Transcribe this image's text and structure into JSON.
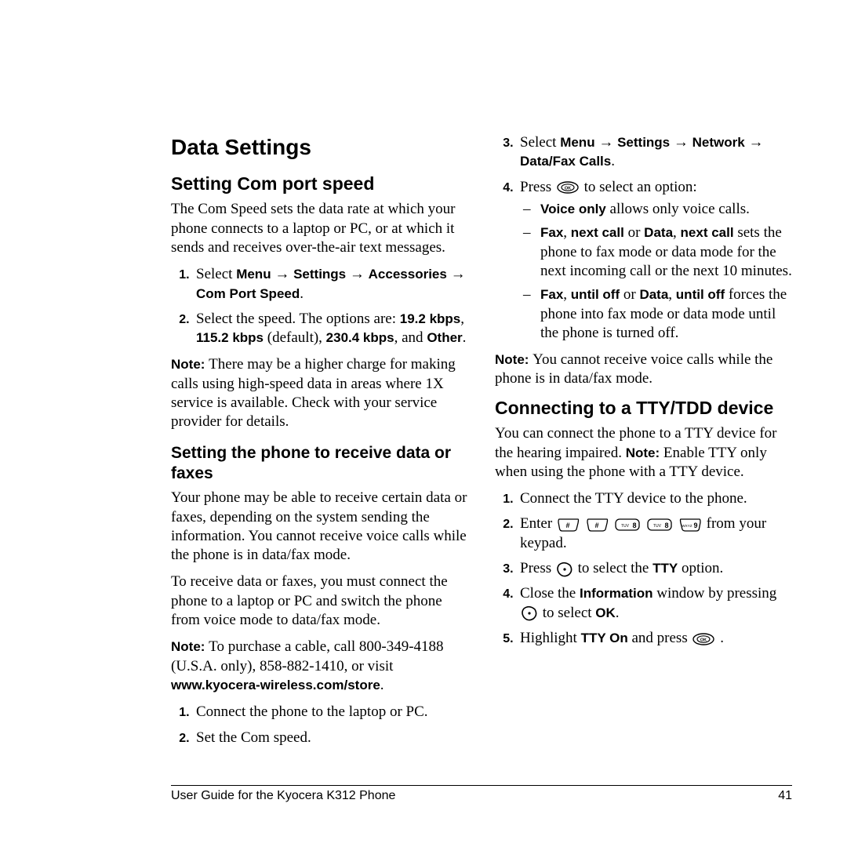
{
  "left": {
    "h1": "Data Settings",
    "h2_com": "Setting Com port speed",
    "p_com": "The Com Speed sets the data rate at which your phone connects to a laptop or PC, or at which it sends and receives over-the-air text messages.",
    "step1_a": "Select ",
    "step1_menu": "Menu",
    "step1_settings": "Settings",
    "step1_acc": "Accessories",
    "step1_com": "Com Port Speed",
    "step2_a": "Select the speed. The options are: ",
    "step2_k192": "19.2 kbps",
    "step2_mid": ", ",
    "step2_k1152": "115.2 kbps",
    "step2_def": " (default), ",
    "step2_k2304": "230.4 kbps",
    "step2_and": ", and ",
    "step2_other": "Other",
    "note1_lbl": "Note:  ",
    "note1_txt": "There may be a higher charge for making calls using high-speed data in areas where 1X service is available. Check with your service provider for details.",
    "h3_fax": "Setting the phone to receive data or faxes",
    "p_fax1": "Your phone may be able to receive certain data or faxes, depending on the system sending the information. You cannot receive voice calls while the phone is in data/fax mode.",
    "p_fax2": "To receive data or faxes, you must connect the phone to a laptop or PC and switch the phone from voice mode to data/fax mode.",
    "note2_lbl": "Note:  ",
    "note2_txt": "To purchase a cable, call 800-349-4188 (U.S.A. only), 858-882-1410, or visit ",
    "note2_url": "www.kyocera-wireless.com/store",
    "fax_s1": "Connect the phone to the laptop or PC.",
    "fax_s2": "Set the Com speed."
  },
  "right": {
    "s3_a": "Select ",
    "s3_menu": "Menu",
    "s3_settings": "Settings",
    "s3_network": "Network",
    "s3_datafax": "Data/Fax Calls",
    "s4_a": "Press ",
    "s4_b": " to select an option:",
    "opt1_b": "Voice only",
    "opt1_t": " allows only voice calls.",
    "opt2_b1": "Fax",
    "opt2_c1": ", ",
    "opt2_b2": "next call",
    "opt2_or": " or ",
    "opt2_b3": "Data",
    "opt2_b4": "next call",
    "opt2_t": " sets the phone to fax mode or data mode for the next incoming call or the next 10 minutes.",
    "opt3_b1": "Fax",
    "opt3_b2": "until off",
    "opt3_or": " or ",
    "opt3_b3": "Data",
    "opt3_b4": "until off",
    "opt3_t": " forces the phone into fax mode or data mode until the phone is turned off.",
    "note3_lbl": "Note:  ",
    "note3_txt": "You cannot receive voice calls while the phone is in data/fax mode.",
    "h2_tty": "Connecting to a TTY/TDD device",
    "p_tty_a": "You can connect the phone to a TTY device for the hearing impaired. ",
    "p_tty_note": "Note:",
    "p_tty_b": " Enable TTY only when using the phone with a TTY device.",
    "tty_s1": "Connect the TTY device to the phone.",
    "tty_s2_a": "Enter ",
    "tty_s2_b": " from your keypad.",
    "tty_s3_a": "Press ",
    "tty_s3_b": " to select the ",
    "tty_s3_tty": "TTY",
    "tty_s3_c": " option.",
    "tty_s4_a": "Close the ",
    "tty_s4_info": "Information",
    "tty_s4_b": " window by pressing ",
    "tty_s4_c": " to select ",
    "tty_s4_ok": "OK",
    "tty_s5_a": "Highlight ",
    "tty_s5_on": "TTY On",
    "tty_s5_b": " and press "
  },
  "footer": {
    "left": "User Guide for the Kyocera K312 Phone",
    "right": "41"
  },
  "arrow": " → "
}
